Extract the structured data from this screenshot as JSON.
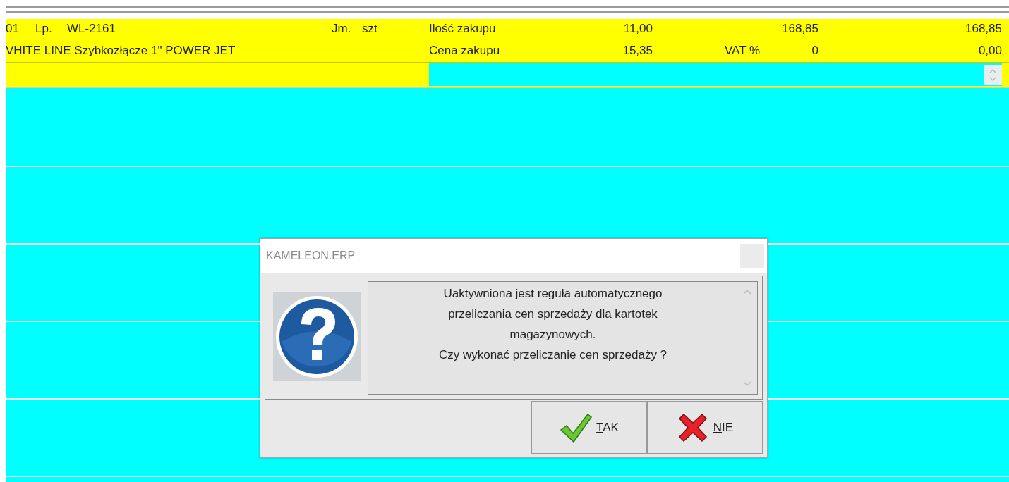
{
  "item": {
    "number": "01",
    "lp_label": "Lp.",
    "code": "WL-2161",
    "unit_label": "Jm.",
    "unit": "szt",
    "quantity_label": "Ilość zakupu",
    "quantity": "11,00",
    "column_3": "168,85",
    "column_4": "168,85",
    "name": "VHITE LINE Szybkozłącze 1\" POWER JET",
    "price_label": "Cena zakupu",
    "price": "15,35",
    "vat_label": "VAT %",
    "vat": "0",
    "vat_amount": "0,00"
  },
  "dialog": {
    "title": "KAMELEON.ERP",
    "message": "Uaktywniona jest reguła automatycznego\nprzeliczania cen sprzedaży dla kartotek\nmagazynowych.\nCzy wykonać przeliczanie cen sprzedaży ?",
    "buttons": [
      {
        "label": "TAK",
        "kind": "yes"
      },
      {
        "label": "NIE",
        "kind": "no"
      }
    ]
  }
}
